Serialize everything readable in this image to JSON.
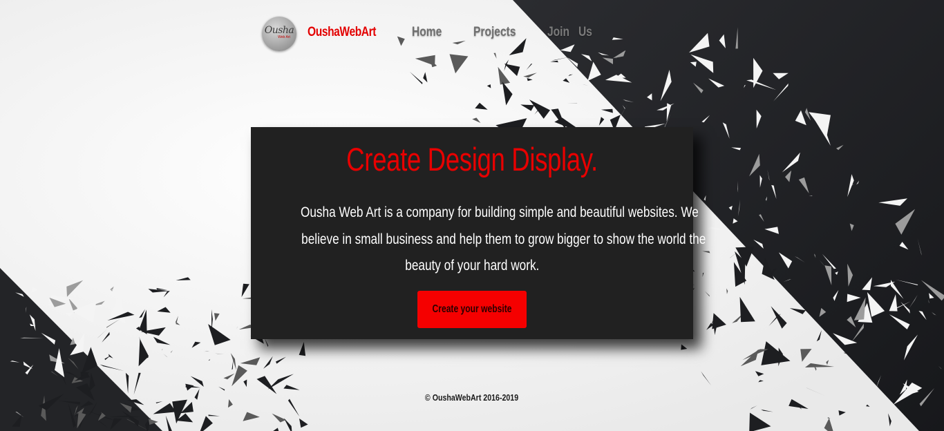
{
  "header": {
    "logo_text": "Ousha",
    "logo_subtext": "Web Art",
    "brand": "OushaWebArt",
    "nav": {
      "home": "Home",
      "projects": "Projects",
      "join": "Join   Us"
    }
  },
  "hero": {
    "title": "Create Design Display.",
    "description_lines": [
      "Ousha Web Art is a company for building simple and beautiful websites. We",
      "believe in small business and help them to grow bigger to show the world the",
      "beauty of your hard work."
    ],
    "cta_label": "Create your website"
  },
  "footer": {
    "copyright": "© OushaWebArt 2016-2019"
  },
  "colors": {
    "accent": "#e80000",
    "hero_bg": "#212121",
    "dark_bg": "#1c1c1e"
  }
}
